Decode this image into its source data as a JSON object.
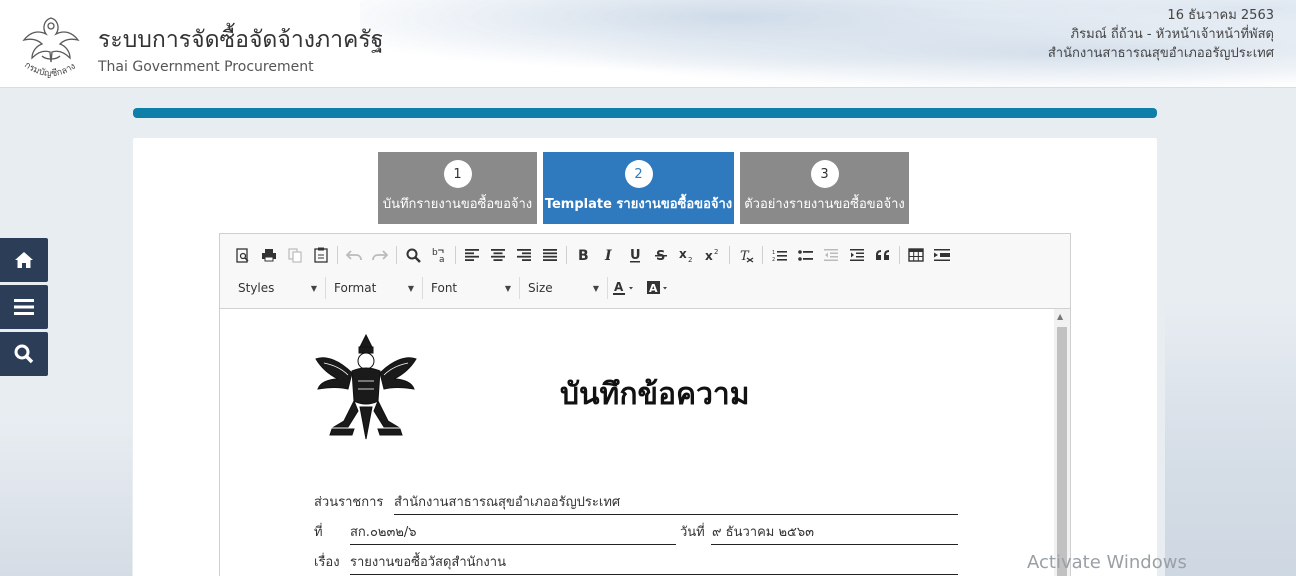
{
  "header": {
    "system_title": "ระบบการจัดซื้อจัดจ้างภาครัฐ",
    "system_subtitle": "Thai Government Procurement",
    "logo_text": "กรมบัญชีกลาง",
    "date": "16 ธันวาคม 2563",
    "user_name_role": "ภิรมณ์ ถี่ถ้วน - หัวหน้าเจ้าหน้าที่พัสดุ",
    "organization": "สำนักงานสาธารณสุขอำเภออรัญประเทศ"
  },
  "steps": [
    {
      "number": "1",
      "label": "บันทึกรายงานขอซื้อขอจ้าง"
    },
    {
      "number": "2",
      "label": "Template รายงานขอซื้อขอจ้าง"
    },
    {
      "number": "3",
      "label": "ตัวอย่างรายงานขอซื้อขอจ้าง"
    }
  ],
  "active_step": 2,
  "toolbar": {
    "combos": {
      "styles": "Styles",
      "format": "Format",
      "font": "Font",
      "size": "Size"
    }
  },
  "document": {
    "title": "บันทึกข้อความ",
    "agency_label": "ส่วนราชการ",
    "agency_value": "สำนักงานสาธารณสุขอำเภออรัญประเทศ",
    "ref_label": "ที่",
    "ref_value": "สก.๐๒๓๒/๖",
    "date_label": "วันที่",
    "date_value": "๙ ธันวาคม ๒๕๖๓",
    "subject_label": "เรื่อง",
    "subject_value": "รายงานขอซื้อวัสดุสำนักงาน"
  },
  "watermark": "Activate Windows",
  "colors": {
    "progress": "#0e7fa8",
    "active_step": "#2f7abf",
    "inactive_step": "#8a8a8a",
    "side_nav": "#2c3e57"
  }
}
